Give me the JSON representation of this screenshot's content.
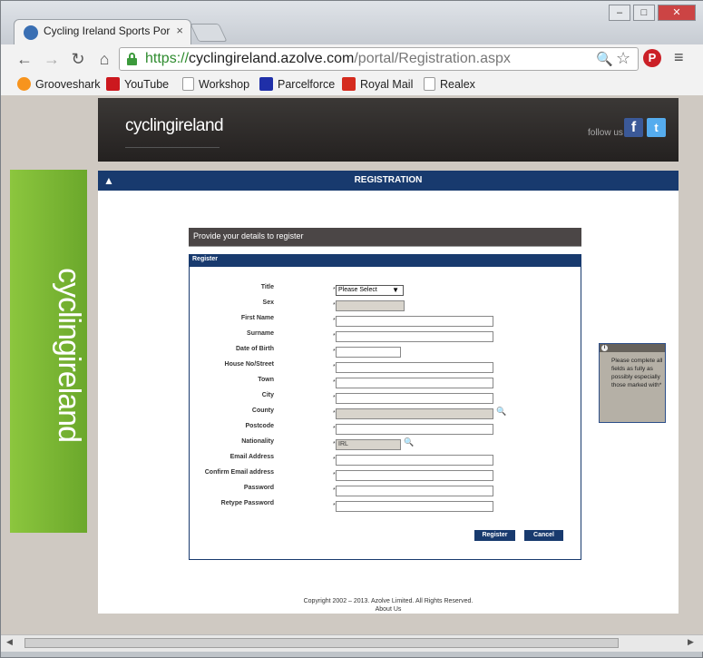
{
  "browser": {
    "tab_title": "Cycling Ireland Sports Por",
    "tab_close": "×",
    "url_scheme": "https://",
    "url_host": "cyclingireland.azolve.com",
    "url_path": "/portal/Registration.aspx",
    "window_buttons": [
      "–",
      "□",
      "✕"
    ],
    "nav": {
      "back": "←",
      "forward": "→",
      "reload": "↻",
      "home": "⌂"
    },
    "search_glyph": "🔍",
    "star_glyph": "☆",
    "pinterest": "P",
    "menu_glyph": "≡"
  },
  "bookmarks": [
    {
      "label": "Grooveshark",
      "icon": "grooveshark-icon",
      "color": "#f7941d"
    },
    {
      "label": "YouTube",
      "icon": "youtube-icon",
      "color": "#cc181e"
    },
    {
      "label": "Workshop",
      "icon": "page-icon",
      "color": "#ffffff"
    },
    {
      "label": "Parcelforce",
      "icon": "parcelforce-icon",
      "color": "#1f2fa8"
    },
    {
      "label": "Royal Mail",
      "icon": "royal-mail-icon",
      "color": "#d52b1e"
    },
    {
      "label": "Realex",
      "icon": "page-icon",
      "color": "#ffffff"
    }
  ],
  "site": {
    "logo": "cyclingireland",
    "side_logo": "cyclingireland",
    "follow_text": "follow us",
    "facebook": "f",
    "twitter": "t"
  },
  "registration": {
    "header": "REGISTRATION",
    "provide_heading": "Provide your details to register",
    "panel_title": "Register",
    "fields": [
      {
        "label": "Title",
        "value": "Please Select"
      },
      {
        "label": "Sex",
        "value": ""
      },
      {
        "label": "First Name",
        "value": ""
      },
      {
        "label": "Surname",
        "value": ""
      },
      {
        "label": "Date of Birth",
        "value": ""
      },
      {
        "label": "House No/Street",
        "value": ""
      },
      {
        "label": "Town",
        "value": ""
      },
      {
        "label": "City",
        "value": ""
      },
      {
        "label": "County",
        "value": ""
      },
      {
        "label": "Postcode",
        "value": ""
      },
      {
        "label": "Nationality",
        "value": "IRL"
      },
      {
        "label": "Email Address",
        "value": ""
      },
      {
        "label": "Confirm Email address",
        "value": ""
      },
      {
        "label": "Password",
        "value": ""
      },
      {
        "label": "Retype Password",
        "value": ""
      }
    ],
    "required_mark": "*",
    "register_button": "Register",
    "cancel_button": "Cancel",
    "hint_text": "Please complete all fields as fully as possibly especially those marked with*"
  },
  "footer": {
    "copyright": "Copyright 2002 – 2013. Azolve Limited. All Rights Reserved.",
    "about": "About Us"
  },
  "colors": {
    "accent_navy": "#183a6e",
    "sidebar_green": "#7cb733"
  }
}
